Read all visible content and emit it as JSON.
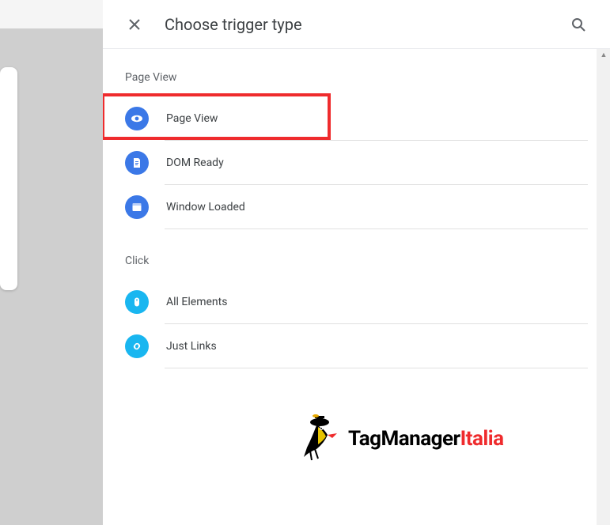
{
  "header": {
    "title": "Choose trigger type"
  },
  "sections": {
    "pageView": {
      "title": "Page View",
      "items": {
        "pageView": "Page View",
        "domReady": "DOM Ready",
        "windowLoaded": "Window Loaded"
      }
    },
    "click": {
      "title": "Click",
      "items": {
        "allElements": "All Elements",
        "justLinks": "Just Links"
      }
    }
  },
  "logo": {
    "brand1": "TagManager",
    "brand2": "Italia"
  }
}
